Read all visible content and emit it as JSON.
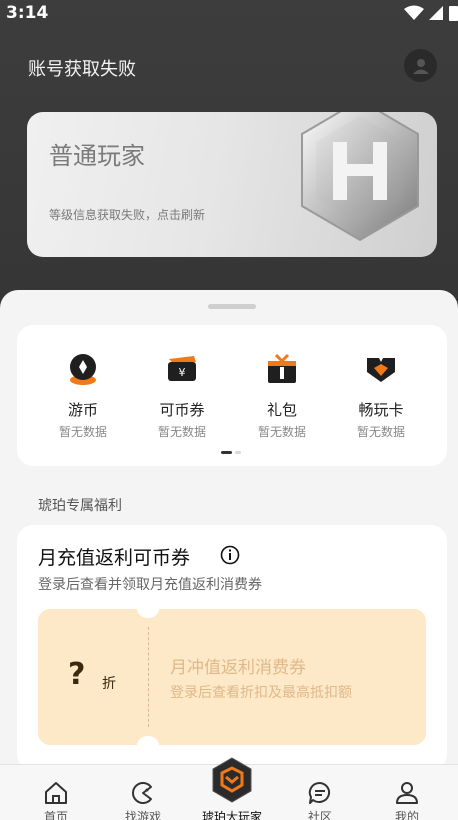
{
  "status_bar": {
    "time": "3:14"
  },
  "header": {
    "title": "账号获取失败"
  },
  "level_card": {
    "name": "普通玩家",
    "subtitle": "等级信息获取失败，点击刷新"
  },
  "assets": [
    {
      "label": "游币",
      "value": "暂无数据",
      "icon": "coin-icon"
    },
    {
      "label": "可币券",
      "value": "暂无数据",
      "icon": "ticket-icon"
    },
    {
      "label": "礼包",
      "value": "暂无数据",
      "icon": "gift-icon"
    },
    {
      "label": "畅玩卡",
      "value": "暂无数据",
      "icon": "play-card-icon"
    }
  ],
  "section": {
    "label": "琥珀专属福利"
  },
  "rebate": {
    "title": "月充值返利可币券",
    "subtitle": "登录后查看并领取月充值返利消费券",
    "coupon": {
      "discount": "?",
      "unit": "折",
      "name": "月冲值返利消费券",
      "desc": "登录后查看折扣及最高抵扣额"
    }
  },
  "bottom_nav": [
    {
      "label": "首页",
      "icon": "home-icon"
    },
    {
      "label": "找游戏",
      "icon": "find-game-icon"
    },
    {
      "label": "琥珀大玩家",
      "icon": "amber-player-icon",
      "active": true
    },
    {
      "label": "社区",
      "icon": "community-icon"
    },
    {
      "label": "我的",
      "icon": "profile-icon"
    }
  ],
  "colors": {
    "accent_orange": "#f07a1a",
    "coupon_bg": "#fde8c8",
    "coupon_text": "#e0b98a"
  }
}
